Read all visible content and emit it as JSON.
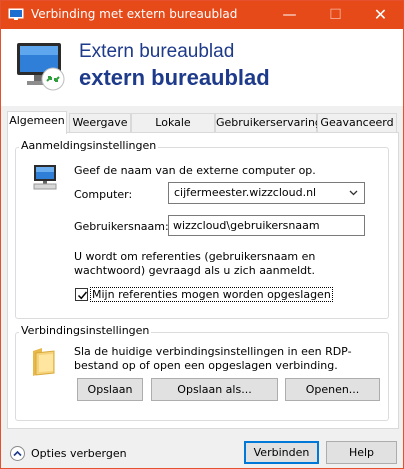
{
  "window": {
    "title": "Verbinding met extern bureaublad"
  },
  "titlebar": {
    "minimize": "—",
    "maximize": "☐",
    "close": "✕"
  },
  "header": {
    "line1": "Extern bureaublad",
    "line2": "extern bureaublad"
  },
  "tabs": [
    {
      "label": "Algemeen",
      "active": true
    },
    {
      "label": "Weergave",
      "active": false
    },
    {
      "label": "Lokale bronnen",
      "active": false
    },
    {
      "label": "Gebruikerservaring",
      "active": false
    },
    {
      "label": "Geavanceerd",
      "active": false
    }
  ],
  "logon": {
    "title": "Aanmeldingsinstellingen",
    "instruction": "Geef de naam van de externe computer op.",
    "computer_label": "Computer:",
    "computer_value": "cijfermeester.wizzcloud.nl",
    "username_label": "Gebruikersnaam:",
    "username_value": "wizzcloud\\gebruikersnaam",
    "info": "U wordt om referenties (gebruikersnaam en wachtwoord) gevraagd als u zich aanmeldt.",
    "save_credentials_label": "Mijn referenties mogen worden opgeslagen",
    "save_credentials_checked": true
  },
  "connection": {
    "title": "Verbindingsinstellingen",
    "info": "Sla de huidige verbindingsinstellingen in een RDP-bestand op of open een opgeslagen verbinding.",
    "save_label": "Opslaan",
    "save_as_label": "Opslaan als...",
    "open_label": "Openen..."
  },
  "footer": {
    "options_label": "Opties verbergen",
    "connect_label": "Verbinden",
    "help_label": "Help"
  },
  "colors": {
    "titlebar": "#e64a19",
    "header_text": "#1e3a8a",
    "focus": "#0078d7"
  }
}
